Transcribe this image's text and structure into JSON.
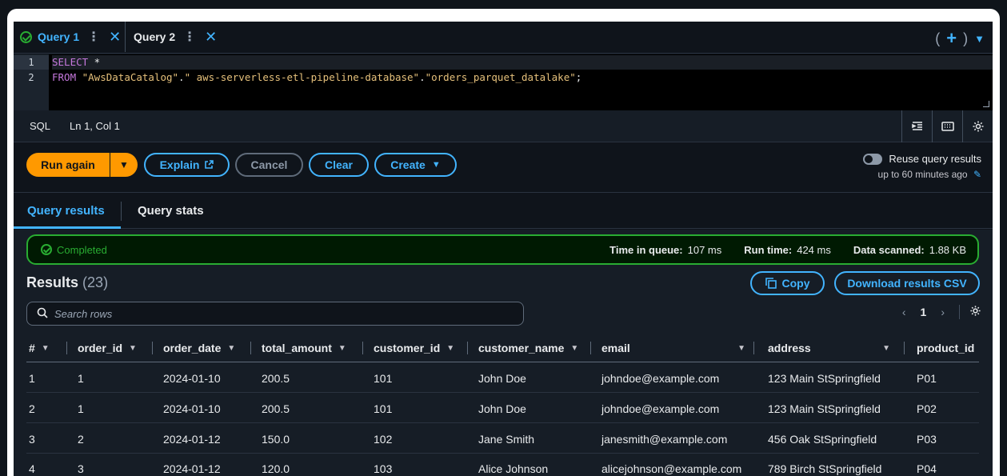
{
  "tabs": [
    {
      "label": "Query 1",
      "status": "completed"
    },
    {
      "label": "Query 2",
      "status": "none"
    }
  ],
  "tab_tools": {
    "open_paren": "(",
    "plus": "+",
    "close_paren": ")",
    "caret": "▼"
  },
  "editor": {
    "line_numbers": [
      "1",
      "2"
    ],
    "line1": {
      "kw": "SELECT",
      "rest": " *"
    },
    "line2": {
      "kw": "FROM",
      "s1": " \"AwsDataCatalog\"",
      "dot1": ".",
      "s2": "\" aws-serverless-etl-pipeline-database\"",
      "dot2": ".",
      "s3": "\"orders_parquet_datalake\"",
      "end": ";"
    }
  },
  "status_bar": {
    "language": "SQL",
    "cursor": "Ln 1, Col 1"
  },
  "actions": {
    "run_again": "Run again",
    "explain": "Explain",
    "cancel": "Cancel",
    "clear": "Clear",
    "create": "Create",
    "reuse_label": "Reuse query results",
    "reuse_sub": "up to 60 minutes ago"
  },
  "result_tabs": [
    "Query results",
    "Query stats"
  ],
  "completion": {
    "status": "Completed",
    "queue_label": "Time in queue:",
    "queue_value": "107 ms",
    "run_label": "Run time:",
    "run_value": "424 ms",
    "scanned_label": "Data scanned:",
    "scanned_value": "1.88 KB"
  },
  "results": {
    "title": "Results",
    "count": "(23)",
    "copy": "Copy",
    "download": "Download results CSV",
    "search_placeholder": "Search rows",
    "page": "1"
  },
  "table": {
    "columns": [
      "#",
      "order_id",
      "order_date",
      "total_amount",
      "customer_id",
      "customer_name",
      "email",
      "address",
      "product_id"
    ],
    "rows": [
      [
        "1",
        "1",
        "2024-01-10",
        "200.5",
        "101",
        "John Doe",
        "johndoe@example.com",
        "123 Main StSpringfield",
        "P01"
      ],
      [
        "2",
        "1",
        "2024-01-10",
        "200.5",
        "101",
        "John Doe",
        "johndoe@example.com",
        "123 Main StSpringfield",
        "P02"
      ],
      [
        "3",
        "2",
        "2024-01-12",
        "150.0",
        "102",
        "Jane Smith",
        "janesmith@example.com",
        "456 Oak StSpringfield",
        "P03"
      ],
      [
        "4",
        "3",
        "2024-01-12",
        "120.0",
        "103",
        "Alice Johnson",
        "alicejohnson@example.com",
        "789 Birch StSpringfield",
        "P04"
      ]
    ]
  },
  "colors": {
    "accent": "#42b4ff",
    "run": "#ff9900",
    "success": "#29ad32"
  }
}
